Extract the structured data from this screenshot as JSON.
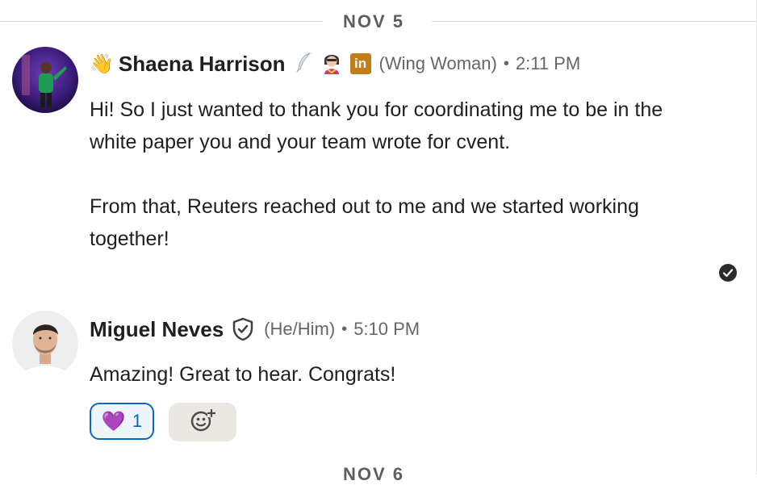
{
  "dividers": {
    "first": "NOV 5",
    "second": "NOV 6"
  },
  "messages": [
    {
      "sender": "Shaena Harrison",
      "pronoun": "(Wing Woman)",
      "separator": "•",
      "time": "2:11 PM",
      "leading_emoji": "👋",
      "badges": [
        "feather-icon",
        "superhero-icon",
        "linkedin-icon"
      ],
      "linkedin_badge_text": "in",
      "paragraphs": [
        "Hi! So I just wanted to thank you for coordinating me to be in the white paper you and your team wrote for cvent.",
        "From that, Reuters reached out to me and we started working together!"
      ],
      "read_receipt_icon": "check-circle-icon"
    },
    {
      "sender": "Miguel Neves",
      "pronoun": "(He/Him)",
      "separator": "•",
      "time": "5:10 PM",
      "badges": [
        "verified-shield-icon"
      ],
      "paragraphs": [
        "Amazing! Great to hear. Congrats!"
      ],
      "reactions": [
        {
          "emoji": "💜",
          "count": "1"
        }
      ],
      "add_reaction_icon": "add-emoji-icon"
    }
  ],
  "colors": {
    "accent": "#0a66c2",
    "linkedin_badge": "#c37d16",
    "reaction_bg": "#eef5fd",
    "add_reaction_bg": "#ebe8e3"
  }
}
